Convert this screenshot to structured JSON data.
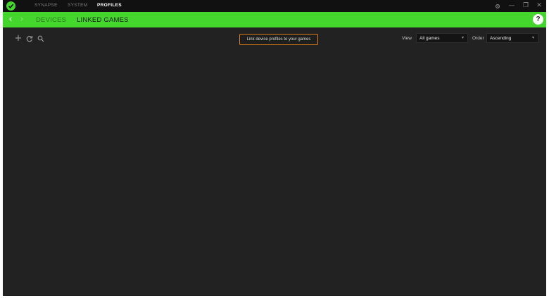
{
  "titlebar": {
    "tabs": [
      {
        "label": "SYNAPSE",
        "active": false
      },
      {
        "label": "SYSTEM",
        "active": false
      },
      {
        "label": "PROFILES",
        "active": true
      }
    ],
    "controls": {
      "settings_icon": "gear-icon",
      "minimize": "—",
      "maximize": "❐",
      "close": "✕"
    }
  },
  "navbar": {
    "back": "‹",
    "forward": "›",
    "tabs": [
      {
        "label": "DEVICES",
        "active": false
      },
      {
        "label": "LINKED GAMES",
        "active": true
      }
    ],
    "help": "?"
  },
  "toolbar": {
    "add": "+",
    "refresh": "↻",
    "search": "⚲",
    "hint": "Link device profiles to your games",
    "view_label": "View",
    "view_value": "All games",
    "order_label": "Order",
    "order_value": "Ascending",
    "chevron": "▾"
  },
  "colors": {
    "accent": "#44d62c",
    "background": "#222222",
    "titlebar": "#111111",
    "hint_border": "#d97a15"
  }
}
